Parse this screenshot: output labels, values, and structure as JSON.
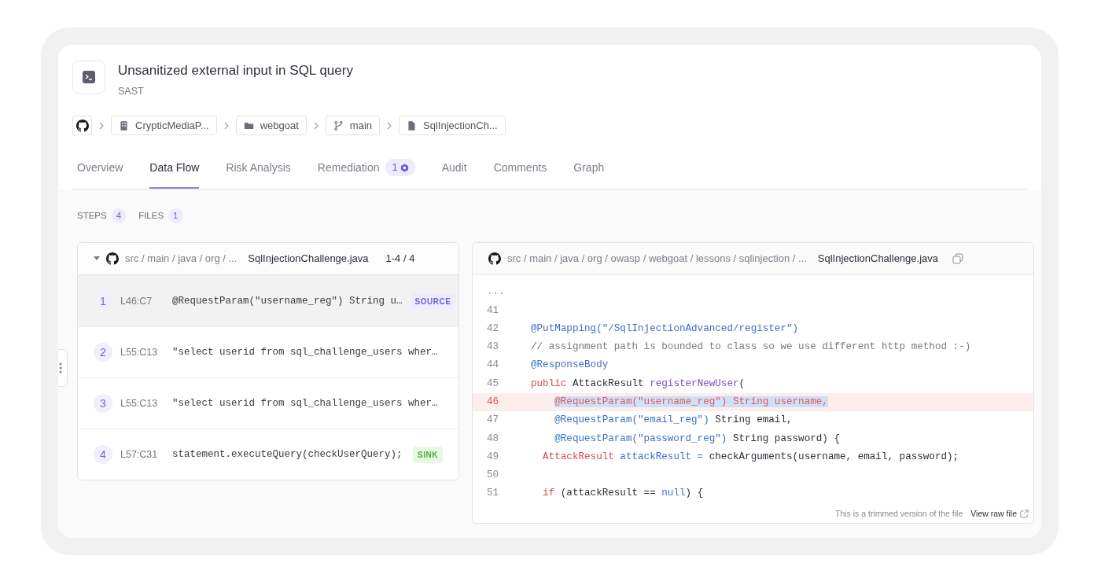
{
  "issue": {
    "title": "Unsanitized external input in SQL query",
    "category": "SAST"
  },
  "breadcrumbs": [
    {
      "kind": "repo",
      "label": "CrypticMediaP..."
    },
    {
      "kind": "folder",
      "label": "webgoat"
    },
    {
      "kind": "branch",
      "label": "main"
    },
    {
      "kind": "file",
      "label": "SqlInjectionCh..."
    }
  ],
  "tabs": [
    {
      "label": "Overview",
      "selected": false
    },
    {
      "label": "Data Flow",
      "selected": true
    },
    {
      "label": "Risk Analysis",
      "selected": false
    },
    {
      "label": "Remediation",
      "selected": false,
      "badge": "1"
    },
    {
      "label": "Audit",
      "selected": false
    },
    {
      "label": "Comments",
      "selected": false
    },
    {
      "label": "Graph",
      "selected": false
    }
  ],
  "counters": [
    {
      "label": "STEPS",
      "count": "4"
    },
    {
      "label": "FILES",
      "count": "1"
    }
  ],
  "steps_panel": {
    "path": "src / main / java / org / ...",
    "file": "SqlInjectionChallenge.java",
    "range": "1-4 / 4",
    "expanded": true,
    "steps": [
      {
        "number": "1",
        "location": "L46:C7",
        "code": "@RequestParam(\"username_reg\") String u…",
        "tag": {
          "kind": "source",
          "label": "SOURCE"
        },
        "selected": true
      },
      {
        "number": "2",
        "location": "L55:C13",
        "code": "\"select userid from sql_challenge_users wher…",
        "selected": false
      },
      {
        "number": "3",
        "location": "L55:C13",
        "code": "\"select userid from sql_challenge_users wher…",
        "selected": false
      },
      {
        "number": "4",
        "location": "L57:C31",
        "code": "statement.executeQuery(checkUserQuery);",
        "tag": {
          "kind": "sink",
          "label": "SINK"
        },
        "selected": false
      }
    ]
  },
  "code_panel": {
    "path": "src / main / java / org / owasp / webgoat / lessons / sqlinjection / ...",
    "file": "SqlInjectionChallenge.java",
    "ellipsis": "...",
    "lines": [
      {
        "number": "41",
        "highlighted": false
      },
      {
        "number": "42",
        "highlighted": false,
        "kind": "member",
        "tokens": [
          {
            "kind": "annotation",
            "text": "@PutMapping(\"/SqlInjectionAdvanced/register\")"
          }
        ]
      },
      {
        "number": "43",
        "highlighted": false,
        "kind": "member",
        "tokens": [
          {
            "kind": "comment",
            "text": "// assignment path is bounded to class so we use different http method :-)"
          }
        ]
      },
      {
        "number": "44",
        "highlighted": false,
        "kind": "member",
        "tokens": [
          {
            "kind": "annotation",
            "text": "@ResponseBody"
          }
        ]
      },
      {
        "number": "45",
        "highlighted": false,
        "kind": "member",
        "tokens": [
          {
            "kind": "keyword",
            "text": "public"
          },
          {
            "kind": "plain",
            "text": " AttackResult "
          },
          {
            "kind": "method",
            "text": "registerNewUser"
          },
          {
            "kind": "plain",
            "text": "("
          }
        ]
      },
      {
        "number": "46",
        "highlighted": true,
        "kind": "param",
        "tokens": [
          {
            "kind": "selected",
            "text": "@RequestParam(\"username_reg\") String username,"
          }
        ]
      },
      {
        "number": "47",
        "highlighted": false,
        "kind": "param",
        "tokens": [
          {
            "kind": "annotation",
            "text": "@RequestParam(\"email_reg\")"
          },
          {
            "kind": "plain",
            "text": " String email,"
          }
        ]
      },
      {
        "number": "48",
        "highlighted": false,
        "kind": "param",
        "tokens": [
          {
            "kind": "annotation",
            "text": "@RequestParam(\"password_reg\")"
          },
          {
            "kind": "plain",
            "text": " String password) {"
          }
        ]
      },
      {
        "number": "49",
        "highlighted": false,
        "kind": "statement",
        "tokens": [
          {
            "kind": "keyword",
            "text": "AttackResult"
          },
          {
            "kind": "annotation",
            "text": " attackResult ="
          },
          {
            "kind": "plain",
            "text": " checkArguments(username, email, password);"
          }
        ]
      },
      {
        "number": "50",
        "highlighted": false
      },
      {
        "number": "51",
        "highlighted": false,
        "kind": "statement",
        "tokens": [
          {
            "kind": "keyword",
            "text": "if"
          },
          {
            "kind": "plain",
            "text": " (attackResult == "
          },
          {
            "kind": "annotation",
            "text": "null"
          },
          {
            "kind": "plain",
            "text": ") {"
          }
        ]
      }
    ],
    "footer_note": "This is a trimmed version of the file",
    "raw_link": "View raw file"
  }
}
